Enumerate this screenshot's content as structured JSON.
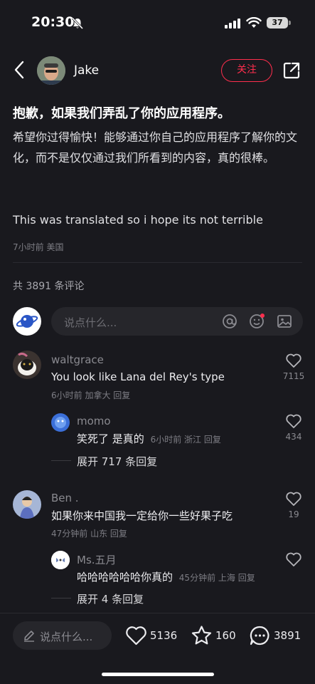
{
  "status": {
    "time": "20:30",
    "battery": "37"
  },
  "header": {
    "author": "Jake",
    "follow_label": "关注"
  },
  "note": {
    "title": "抱歉，如果我们弄乱了你的应用程序。",
    "body_zh": "希望你过得愉快！能够通过你自己的应用程序了解你的文化，而不是仅仅通过我们所看到的内容，真的很棒。",
    "body_en": "This was translated so i hope its not terrible",
    "meta": "7小时前 美国"
  },
  "comments_header": {
    "count": "共 3891 条评论"
  },
  "comment_input": {
    "placeholder": "说点什么..."
  },
  "comments": [
    {
      "user": "waltgrace",
      "text": "You look like Lana del Rey's type",
      "meta": "6小时前 加拿大 回复",
      "likes": "7115",
      "replies": [
        {
          "user": "momo",
          "text": "笑死了 是真的",
          "meta": "6小时前 浙江 回复",
          "likes": "434"
        }
      ],
      "expand": "展开 717 条回复"
    },
    {
      "user": "Ben .",
      "text": "如果你来中国我一定给你一些好果子吃",
      "meta": "47分钟前 山东 回复",
      "likes": "19",
      "replies": [
        {
          "user": "Ms.五月",
          "text": "哈哈哈哈哈哈你真的",
          "meta": "45分钟前 上海 回复",
          "likes": ""
        }
      ],
      "expand": "展开 4 条回复"
    }
  ],
  "bottom_bar": {
    "placeholder": "说点什么...",
    "likes": "5136",
    "stars": "160",
    "comments": "3891"
  },
  "colors": {
    "accent": "#ff2e4d",
    "background": "#19191e"
  }
}
